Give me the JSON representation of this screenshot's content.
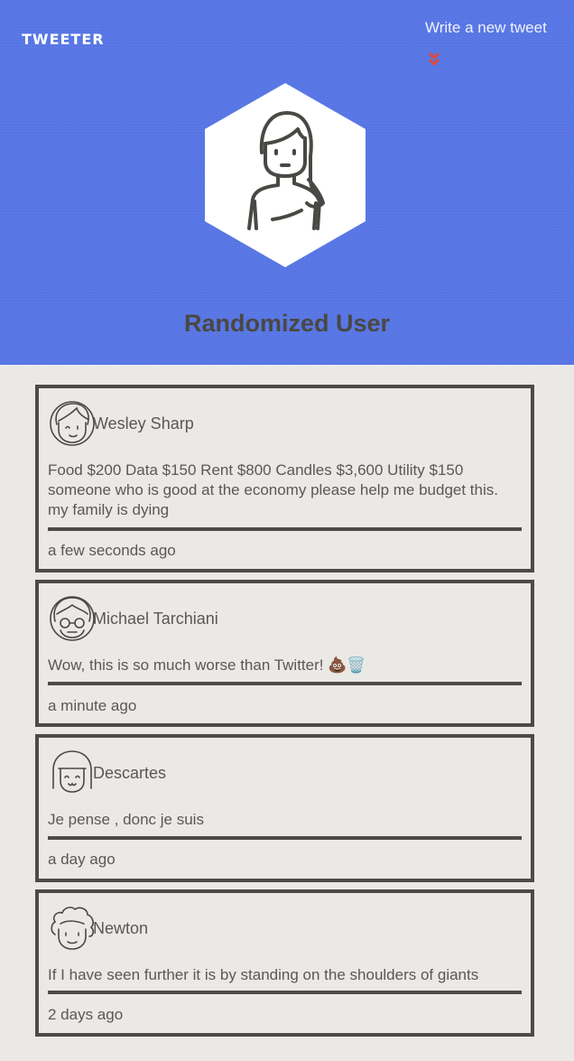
{
  "nav": {
    "brand": "TWEETER",
    "compose_label": "Write a new tweet",
    "toggle_icon": "double-chevron-down-icon",
    "toggle_color": "#e0473c"
  },
  "profile": {
    "name": "Randomized User",
    "avatar_icon": "woman-avatar-icon"
  },
  "colors": {
    "header_bg": "#5877e6",
    "page_bg": "#eae9e5",
    "border": "#4d4b47",
    "text": "#5a5854"
  },
  "tweets": [
    {
      "author": "Wesley Sharp",
      "avatar_icon": "man-avatar-icon",
      "text": "Food $200 Data $150 Rent $800 Candles $3,600 Utility $150 someone who is good at the economy please help me budget this. my family is dying",
      "time": "a few seconds ago"
    },
    {
      "author": "Michael Tarchiani",
      "avatar_icon": "glasses-avatar-icon",
      "text": "Wow, this is so much worse than Twitter! 💩🗑️",
      "time": "a minute ago"
    },
    {
      "author": "Descartes",
      "avatar_icon": "bob-hair-avatar-icon",
      "text": "Je pense , donc je suis",
      "time": "a day ago"
    },
    {
      "author": "Newton",
      "avatar_icon": "curly-hair-avatar-icon",
      "text": "If I have seen further it is by standing on the shoulders of giants",
      "time": "2 days ago"
    }
  ]
}
